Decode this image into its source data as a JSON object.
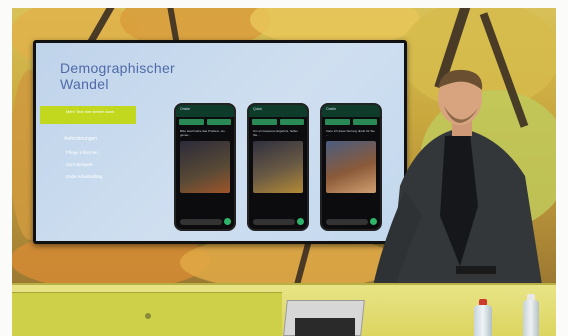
{
  "slide": {
    "title": "Demographischer Wandel",
    "tag_text": "Mehr Text hier stehen kann",
    "sub_heading": "Anforderungen",
    "bullets": [
      "Pflege Informier...",
      "Zum Beispiel..",
      "Ende Arbeitsalltag"
    ]
  },
  "phones": [
    {
      "header": "Onsite",
      "caption": "Bitte beschreibe das Problem, wo genau...",
      "image_tone": "#5a4a36"
    },
    {
      "header": "Quick",
      "caption": "Um ein besseres Ergebnis, helfen Sie ...",
      "image_tone": "#6a5a44"
    },
    {
      "header": "Onsite",
      "caption": "Kann ich diese Störung direkt für Sie ...",
      "image_tone": "#8a5a3a"
    }
  ]
}
